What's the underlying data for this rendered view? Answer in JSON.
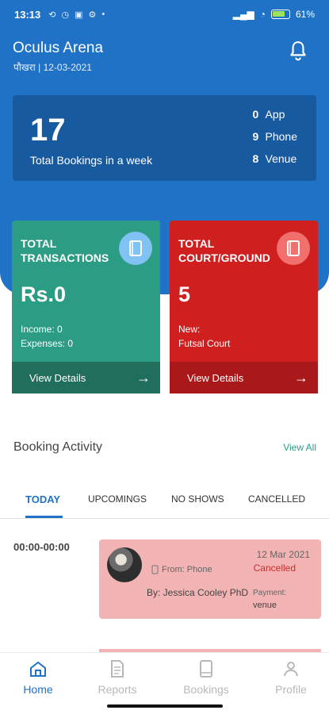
{
  "status_bar": {
    "time": "13:13",
    "battery": "61%"
  },
  "header": {
    "venue_name": "Oculus Arena",
    "location": "पौखरा",
    "date": "12-03-2021"
  },
  "summary": {
    "total_bookings": "17",
    "total_label": "Total Bookings in a week",
    "rows": [
      {
        "count": "0",
        "label": "App"
      },
      {
        "count": "9",
        "label": "Phone"
      },
      {
        "count": "8",
        "label": "Venue"
      }
    ]
  },
  "transactions_card": {
    "title": "TOTAL TRANSACTIONS",
    "value": "Rs.0",
    "line1": "Income: 0",
    "line2": "Expenses: 0",
    "action": "View Details"
  },
  "court_card": {
    "title": "TOTAL COURT/GROUND",
    "value": "5",
    "line1": "New:",
    "line2": "Futsal Court",
    "action": "View Details"
  },
  "booking_activity": {
    "title": "Booking Activity",
    "view_all": "View All"
  },
  "tabs": [
    {
      "label": "TODAY",
      "active": true
    },
    {
      "label": "UPCOMINGS"
    },
    {
      "label": "NO SHOWS"
    },
    {
      "label": "CANCELLED"
    }
  ],
  "booking": {
    "time_slot": "00:00-00:00",
    "date": "12 Mar 2021",
    "status": "Cancelled",
    "source": "From: Phone",
    "by": "By: Jessica Cooley PhD",
    "payment_label": "Payment:",
    "payment_value": "venue"
  },
  "bottom_nav": [
    {
      "label": "Home",
      "active": true
    },
    {
      "label": "Reports"
    },
    {
      "label": "Bookings"
    },
    {
      "label": "Profile"
    }
  ]
}
